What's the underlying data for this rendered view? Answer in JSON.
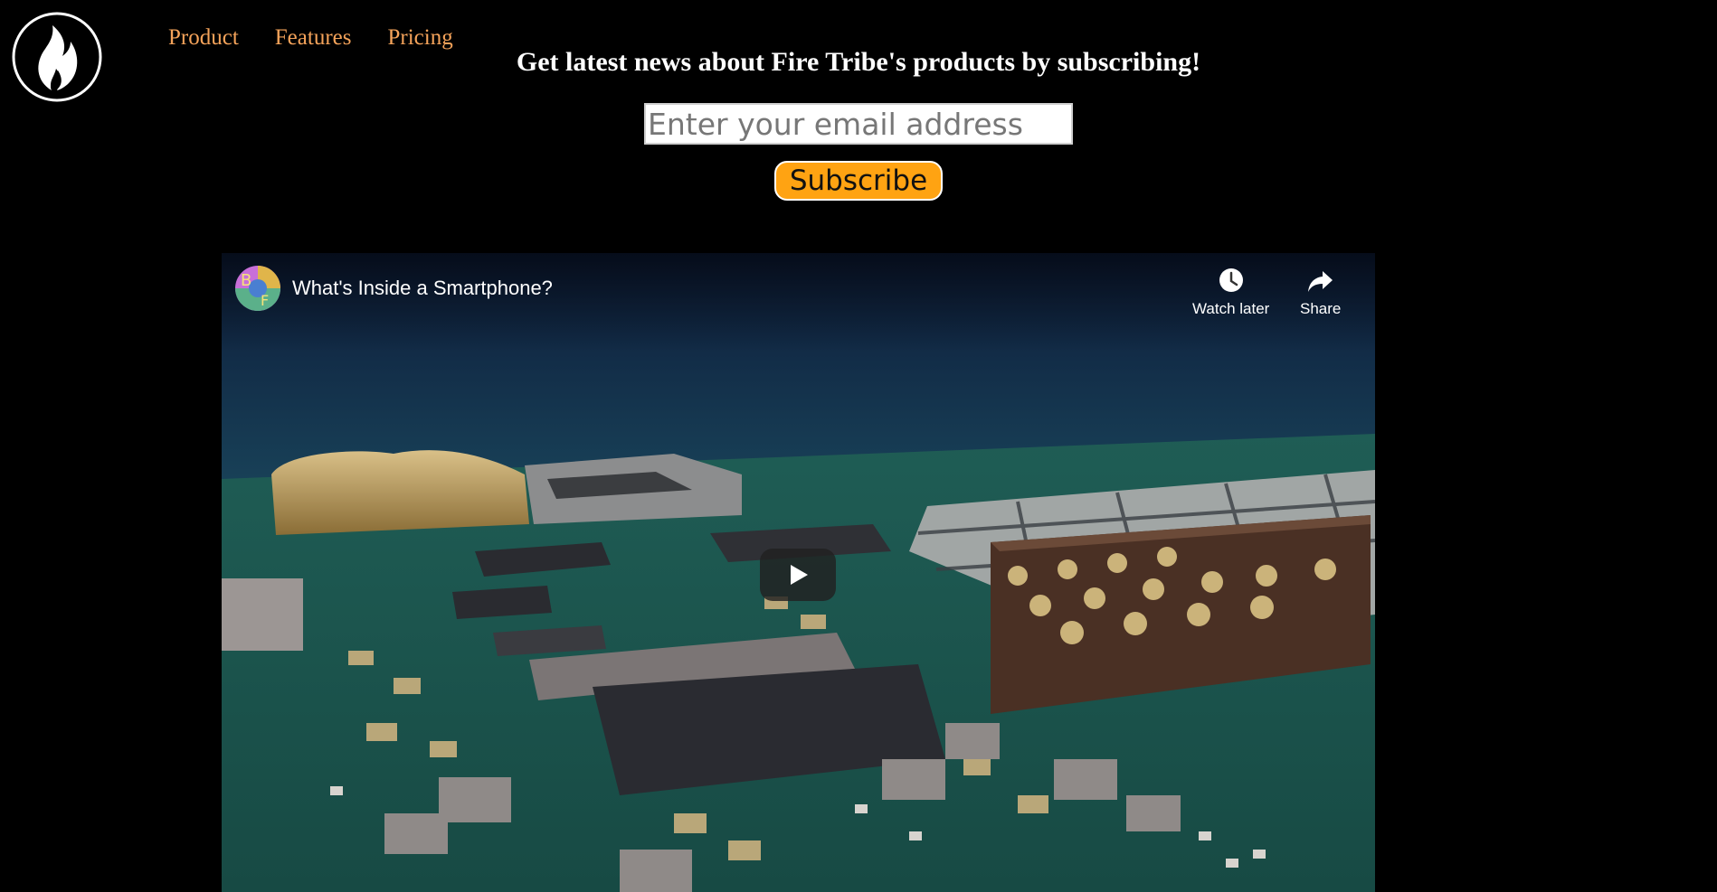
{
  "nav": {
    "items": [
      {
        "label": "Product"
      },
      {
        "label": "Features"
      },
      {
        "label": "Pricing"
      }
    ]
  },
  "subscribe": {
    "headline": "Get latest news about Fire Tribe's products by subscribing!",
    "email_placeholder": "Enter your email address",
    "email_value": "",
    "button_label": "Subscribe"
  },
  "video": {
    "title": "What's Inside a Smartphone?",
    "watch_later_label": "Watch later",
    "share_label": "Share"
  },
  "icons": {
    "logo": "flame-logo-icon",
    "channel": "channel-avatar-icon",
    "watch_later": "clock-icon",
    "share": "share-arrow-icon",
    "play": "play-icon"
  },
  "colors": {
    "background": "#000000",
    "nav_link": "#f5a35a",
    "button": "#ffa312",
    "headline": "#ffffff"
  }
}
